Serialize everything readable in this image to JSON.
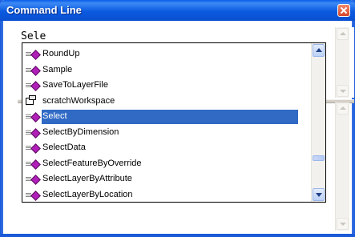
{
  "window": {
    "title": "Command Line"
  },
  "command_input": {
    "value": "Sele"
  },
  "autocomplete": {
    "items": [
      {
        "label": "RoundUp",
        "icon": "tool-icon"
      },
      {
        "label": "Sample",
        "icon": "tool-icon"
      },
      {
        "label": "SaveToLayerFile",
        "icon": "tool-icon"
      },
      {
        "label": "scratchWorkspace",
        "icon": "workspace-icon"
      },
      {
        "label": "Select",
        "icon": "tool-icon",
        "selected": true
      },
      {
        "label": "SelectByDimension",
        "icon": "tool-icon"
      },
      {
        "label": "SelectData",
        "icon": "tool-icon"
      },
      {
        "label": "SelectFeatureByOverride",
        "icon": "tool-icon"
      },
      {
        "label": "SelectLayerByAttribute",
        "icon": "tool-icon"
      },
      {
        "label": "SelectLayerByLocation",
        "icon": "tool-icon"
      }
    ]
  },
  "colors": {
    "titlebar": "#0a5fe8",
    "selection": "#316ac5",
    "tool_icon": "#b01fb8"
  }
}
